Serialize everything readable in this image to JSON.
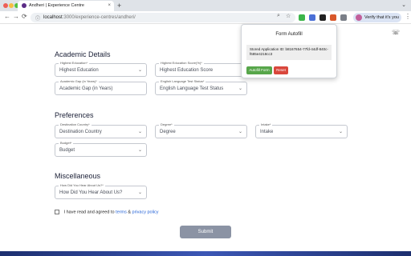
{
  "browser": {
    "tab_title": "Andheri | Experience Centre",
    "tab_close": "×",
    "new_tab": "+",
    "tab_menu": "⌄",
    "back": "←",
    "forward": "→",
    "reload": "⟳",
    "url_host": "localhost",
    "url_path": ":3000/experience-centres/andheri/",
    "profile_label": "Verify that it's you",
    "menu": "⋮"
  },
  "page": {
    "phone_icon": "☏",
    "sections": {
      "academic": "Academic Details",
      "preferences": "Preferences",
      "misc": "Miscellaneous"
    },
    "fields": {
      "highest_education": {
        "label": "Highest Education*",
        "value": "Highest Education"
      },
      "highest_education_score": {
        "label": "Highest Education Score(%)*",
        "value": "Highest Education Score"
      },
      "academic_gap": {
        "label": "Academic Gap (in Years)*",
        "value": "Academic Gap (in Years)"
      },
      "english_test": {
        "label": "English Language Test Status*",
        "value": "English Language Test Status"
      },
      "destination_country": {
        "label": "Destination Country*",
        "value": "Destination Country"
      },
      "degree": {
        "label": "Degree*",
        "value": "Degree"
      },
      "intake": {
        "label": "Intake*",
        "value": "Intake"
      },
      "budget": {
        "label": "Budget*",
        "value": "Budget"
      },
      "hear_about": {
        "label": "How Did You Hear About Us?*",
        "value": "How Did You Hear About Us?"
      }
    },
    "consent": {
      "text": "I have read and agreed to",
      "terms": "terms",
      "amp": "&",
      "privacy": "privacy policy"
    },
    "submit": "Submit"
  },
  "popup": {
    "title": "Form Autofill",
    "stored_prefix": "Stored Application ID:",
    "stored_id": "b8167654-77fd-44df-840c-f685e4218cc3",
    "autofill": "Autofill Form",
    "reset": "Reset"
  },
  "colors": {
    "accent": "#1f5fd6",
    "autofill_green": "#57a64a",
    "reset_red": "#d9473c",
    "submit_gray": "#8b93a4"
  }
}
